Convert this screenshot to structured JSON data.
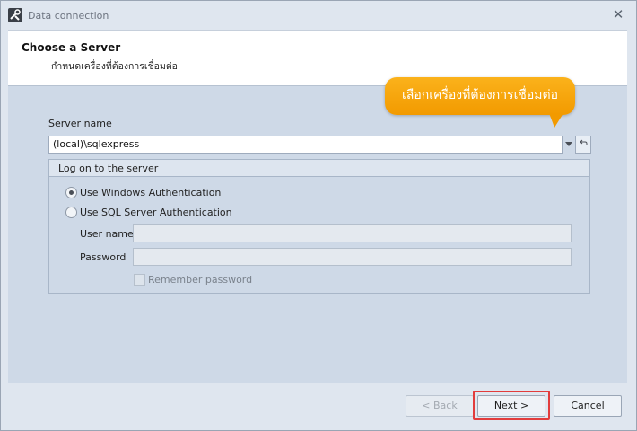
{
  "window": {
    "title": "Data connection",
    "close_glyph": "✕"
  },
  "header": {
    "title": "Choose a Server",
    "subtitle": "กำหนดเครื่องที่ต้องการเชื่อมต่อ"
  },
  "server": {
    "label": "Server name",
    "value": "(local)\\sqlexpress"
  },
  "logon": {
    "group_title": "Log on to the server",
    "options": [
      {
        "label": "Use Windows Authentication",
        "selected": true
      },
      {
        "label": "Use SQL Server Authentication",
        "selected": false
      }
    ],
    "user_label": "User name",
    "user_value": "",
    "password_label": "Password",
    "password_value": "",
    "remember_label": "Remember password"
  },
  "tooltip": {
    "text": "เลือกเครื่องที่ต้องการเชื่อมต่อ",
    "color": "#f6a30a"
  },
  "buttons": {
    "back": "< Back",
    "next": "Next >",
    "cancel": "Cancel"
  },
  "icons": {
    "app": "tools-icon",
    "dropdown": "chevron-down-icon",
    "refresh": "refresh-icon"
  },
  "colors": {
    "highlight": "#e23c3c",
    "content_bg": "#ced9e7"
  }
}
